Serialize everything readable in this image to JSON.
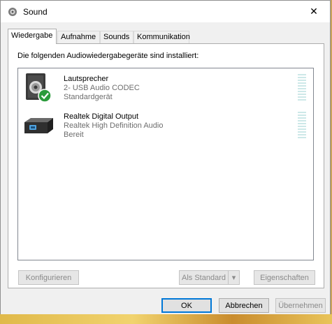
{
  "window": {
    "title": "Sound",
    "close_glyph": "✕"
  },
  "tabs": [
    {
      "label": "Wiedergabe",
      "active": true
    },
    {
      "label": "Aufnahme",
      "active": false
    },
    {
      "label": "Sounds",
      "active": false
    },
    {
      "label": "Kommunikation",
      "active": false
    }
  ],
  "panel": {
    "intro": "Die folgenden Audiowiedergabegeräte sind installiert:",
    "devices": [
      {
        "name": "Lautsprecher",
        "description": "2- USB Audio CODEC",
        "status": "Standardgerät",
        "icon": "speaker-icon",
        "default_badge": "check-icon"
      },
      {
        "name": "Realtek Digital Output",
        "description": "Realtek High Definition Audio",
        "status": "Bereit",
        "icon": "digital-output-icon"
      }
    ],
    "buttons": {
      "configure": "Konfigurieren",
      "set_default": "Als Standard",
      "set_default_dropdown": "▾",
      "properties": "Eigenschaften"
    }
  },
  "footer": {
    "ok": "OK",
    "cancel": "Abbrechen",
    "apply": "Übernehmen"
  },
  "colors": {
    "accent": "#0078d7",
    "check_green": "#2b9b3b",
    "meter": "#cde8e8"
  }
}
